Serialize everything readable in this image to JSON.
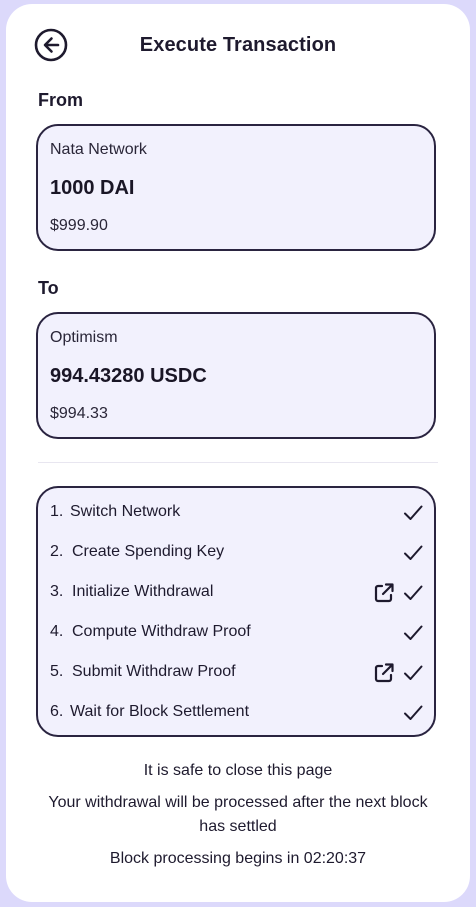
{
  "header": {
    "title": "Execute Transaction",
    "back_icon": "arrow-left-circle-icon"
  },
  "from": {
    "label": "From",
    "network": "Nata Network",
    "amount": "1000 DAI",
    "fiat": "$999.90"
  },
  "to": {
    "label": "To",
    "network": "Optimism",
    "amount": "994.43280 USDC",
    "fiat": "$994.33"
  },
  "steps": [
    {
      "num": "1.",
      "label": "Switch Network",
      "done": true,
      "external_link": false
    },
    {
      "num": "2.",
      "label": "Create Spending Key",
      "done": true,
      "external_link": false
    },
    {
      "num": "3.",
      "label": "Initialize Withdrawal",
      "done": true,
      "external_link": true
    },
    {
      "num": "4.",
      "label": "Compute Withdraw Proof",
      "done": true,
      "external_link": false
    },
    {
      "num": "5.",
      "label": "Submit Withdraw Proof",
      "done": true,
      "external_link": true
    },
    {
      "num": "6.",
      "label": "Wait for Block Settlement",
      "done": true,
      "external_link": false
    }
  ],
  "footer": {
    "safe_text": "It is safe to close this page",
    "withdrawal_text": "Your withdrawal will be processed after the next block has settled",
    "countdown_text": "Block processing begins in 02:20:37"
  },
  "colors": {
    "page_background": "#dcd9fb",
    "card_background": "#ffffff",
    "box_background": "#f2f1fd",
    "border": "#2a2440",
    "text": "#1e1a2e"
  }
}
